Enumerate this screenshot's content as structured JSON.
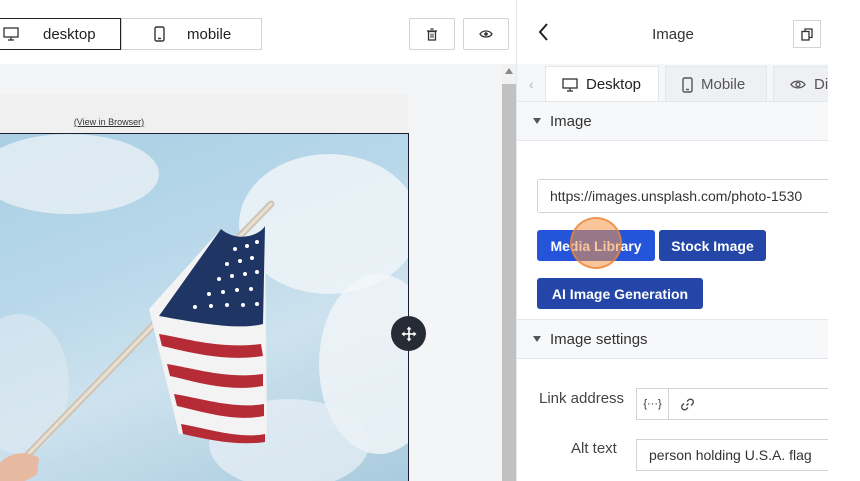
{
  "toolbar": {
    "desktop_label": "desktop",
    "mobile_label": "mobile"
  },
  "email": {
    "view_in_browser": "(View in Browser)"
  },
  "panel": {
    "title": "Image",
    "tabs": [
      {
        "label": "Desktop"
      },
      {
        "label": "Mobile"
      },
      {
        "label": "Di"
      }
    ],
    "image_section": {
      "title": "Image",
      "url_value": "https://images.unsplash.com/photo-1530",
      "buttons": {
        "media_library": "Media Library",
        "stock_image": "Stock Image",
        "ai_generation": "AI Image Generation"
      }
    },
    "settings_section": {
      "title": "Image settings",
      "link_label": "Link address",
      "var_button": "{···}",
      "link_value": "",
      "alt_label": "Alt text",
      "alt_value": "person holding U.S.A. flag"
    }
  },
  "colors": {
    "primary_button": "#2346a8",
    "highlight_ring": "#f5a05a",
    "move_handle": "#262b36"
  }
}
